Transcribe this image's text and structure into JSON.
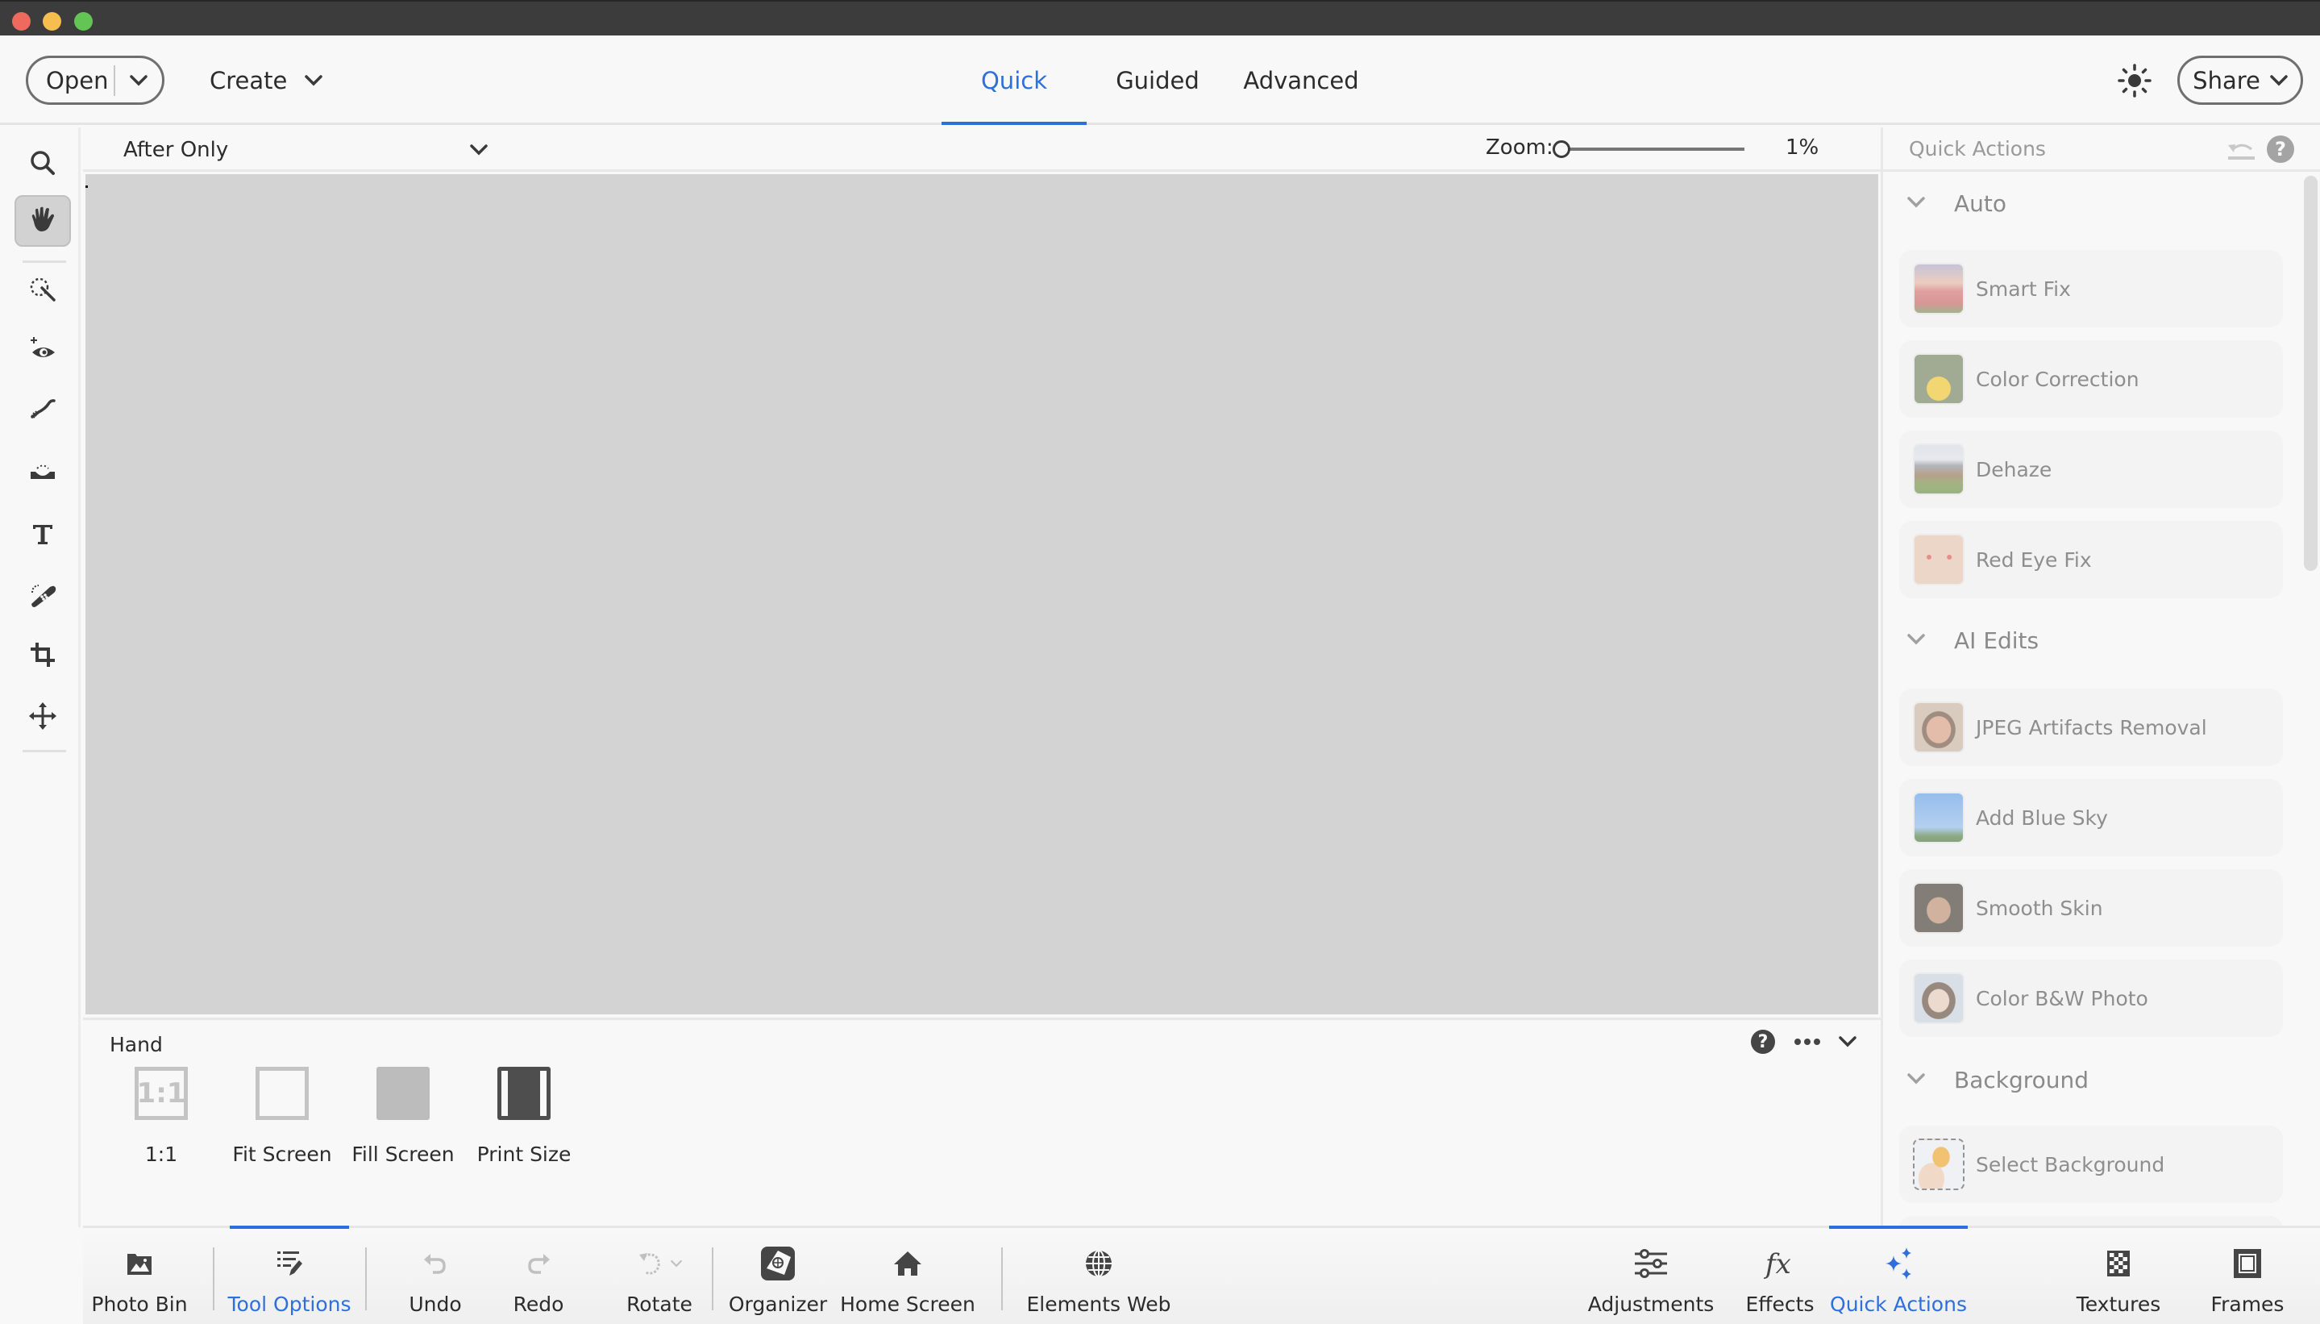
{
  "window": {
    "traffic_lights": [
      "close",
      "minimize",
      "maximize"
    ]
  },
  "header": {
    "open_label": "Open",
    "create_label": "Create",
    "mode_tabs": [
      {
        "label": "Quick",
        "active": true
      },
      {
        "label": "Guided",
        "active": false
      },
      {
        "label": "Advanced",
        "active": false
      }
    ],
    "theme_icon": "sun-icon",
    "share_label": "Share"
  },
  "toolbar": {
    "tools": [
      {
        "name": "zoom-tool",
        "icon": "magnifier-icon",
        "active": false
      },
      {
        "name": "hand-tool",
        "icon": "hand-icon",
        "active": true
      },
      {
        "name": "quick-selection-tool",
        "icon": "quick-selection-icon",
        "active": false
      },
      {
        "name": "eye-tool",
        "icon": "eye-icon",
        "active": false
      },
      {
        "name": "whiten-teeth-tool",
        "icon": "toothbrush-icon",
        "active": false
      },
      {
        "name": "straighten-tool",
        "icon": "straighten-icon",
        "active": false
      },
      {
        "name": "type-tool",
        "icon": "type-icon",
        "active": false
      },
      {
        "name": "spot-healing-tool",
        "icon": "bandage-icon",
        "active": false
      },
      {
        "name": "crop-tool",
        "icon": "crop-icon",
        "active": false
      },
      {
        "name": "move-tool",
        "icon": "move-icon",
        "active": false
      }
    ]
  },
  "options_bar": {
    "view_selected": "After Only",
    "zoom_label": "Zoom:",
    "zoom_value_text": "1%",
    "zoom_fraction": 0.0
  },
  "tool_options": {
    "tool_name": "Hand",
    "buttons": [
      {
        "label": "1:1",
        "icon_text": "1:1",
        "icon": "one-to-one-icon"
      },
      {
        "label": "Fit Screen",
        "icon": "fit-screen-icon"
      },
      {
        "label": "Fill Screen",
        "icon": "fill-screen-icon"
      },
      {
        "label": "Print Size",
        "icon": "print-size-icon"
      }
    ]
  },
  "quick_actions": {
    "title": "Quick Actions",
    "sections": [
      {
        "title": "Auto",
        "items": [
          {
            "label": "Smart Fix",
            "thumb": "tulip-field"
          },
          {
            "label": "Color Correction",
            "thumb": "butterfly-flower"
          },
          {
            "label": "Dehaze",
            "thumb": "barn-mountains"
          },
          {
            "label": "Red Eye Fix",
            "thumb": "face-red-eye"
          }
        ]
      },
      {
        "title": "AI Edits",
        "items": [
          {
            "label": "JPEG Artifacts Removal",
            "thumb": "smiling-woman"
          },
          {
            "label": "Add Blue Sky",
            "thumb": "blue-sky"
          },
          {
            "label": "Smooth Skin",
            "thumb": "smiling-woman-curly"
          },
          {
            "label": "Color B&W Photo",
            "thumb": "vintage-woman"
          }
        ]
      },
      {
        "title": "Background",
        "items": [
          {
            "label": "Select Background",
            "thumb": "parrot-hand"
          }
        ]
      }
    ]
  },
  "bottom_bar": {
    "left": [
      {
        "label": "Photo Bin",
        "icon": "photo-bin-icon",
        "active": false
      },
      {
        "label": "Tool Options",
        "icon": "tool-options-icon",
        "active": true
      },
      {
        "label": "Undo",
        "icon": "undo-icon",
        "active": false
      },
      {
        "label": "Redo",
        "icon": "redo-icon",
        "active": false
      },
      {
        "label": "Rotate",
        "icon": "rotate-icon",
        "active": false
      },
      {
        "label": "Organizer",
        "icon": "organizer-icon",
        "active": false
      },
      {
        "label": "Home Screen",
        "icon": "home-icon",
        "active": false
      },
      {
        "label": "Elements Web",
        "icon": "globe-icon",
        "active": false
      }
    ],
    "right": [
      {
        "label": "Adjustments",
        "icon": "sliders-icon",
        "active": false
      },
      {
        "label": "Effects",
        "icon": "fx-icon",
        "active": false
      },
      {
        "label": "Quick Actions",
        "icon": "sparkle-icon",
        "active": true
      },
      {
        "label": "Textures",
        "icon": "checker-icon",
        "active": false
      },
      {
        "label": "Frames",
        "icon": "frame-icon",
        "active": false
      }
    ]
  },
  "colors": {
    "accent": "#2d6fdc",
    "canvas": "#d3d3d3",
    "panel_bg": "#f8f8f8",
    "titlebar": "#3c3c3c"
  }
}
